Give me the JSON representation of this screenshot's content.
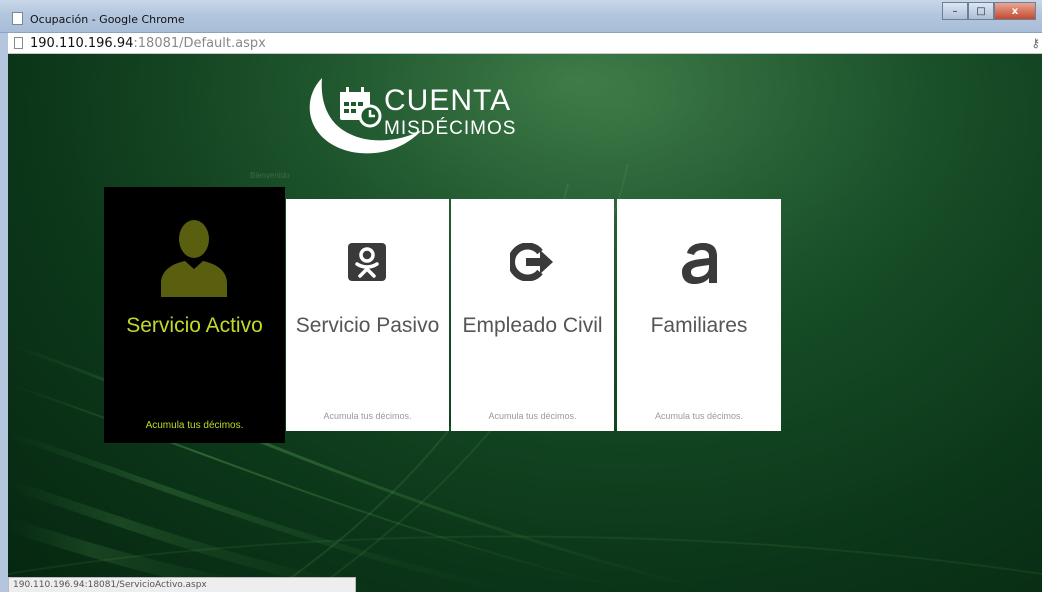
{
  "window": {
    "title": "Ocupación - Google Chrome",
    "minimize": "–",
    "maximize": "□",
    "close": "x"
  },
  "address": {
    "host": "190.110.196.94",
    "rest": ":18081/Default.aspx",
    "key_icon": "key-icon"
  },
  "logo": {
    "line1": "CUENTA",
    "line2": "MISDÉCIMOS",
    "icon": "calendar-clock-icon"
  },
  "watermark": "Bienvenido",
  "tiles": [
    {
      "title": "Servicio Activo",
      "subtitle": "Acumula tus décimos.",
      "icon": "user-silhouette-icon",
      "active": true
    },
    {
      "title": "Servicio Pasivo",
      "subtitle": "Acumula tus décimos.",
      "icon": "odnoklassniki-icon",
      "active": false
    },
    {
      "title": "Empleado Civil",
      "subtitle": "Acumula tus décimos.",
      "icon": "arrow-g-icon",
      "active": false
    },
    {
      "title": "Familiares",
      "subtitle": "Acumula tus décimos.",
      "icon": "letter-a-icon",
      "active": false
    }
  ],
  "status": {
    "url": "190.110.196.94:18081/ServicioActivo.aspx"
  },
  "colors": {
    "accent": "#c3d92a",
    "active_tile_bg": "#000000",
    "tile_bg": "#ffffff",
    "page_bg": "#0b3518"
  }
}
